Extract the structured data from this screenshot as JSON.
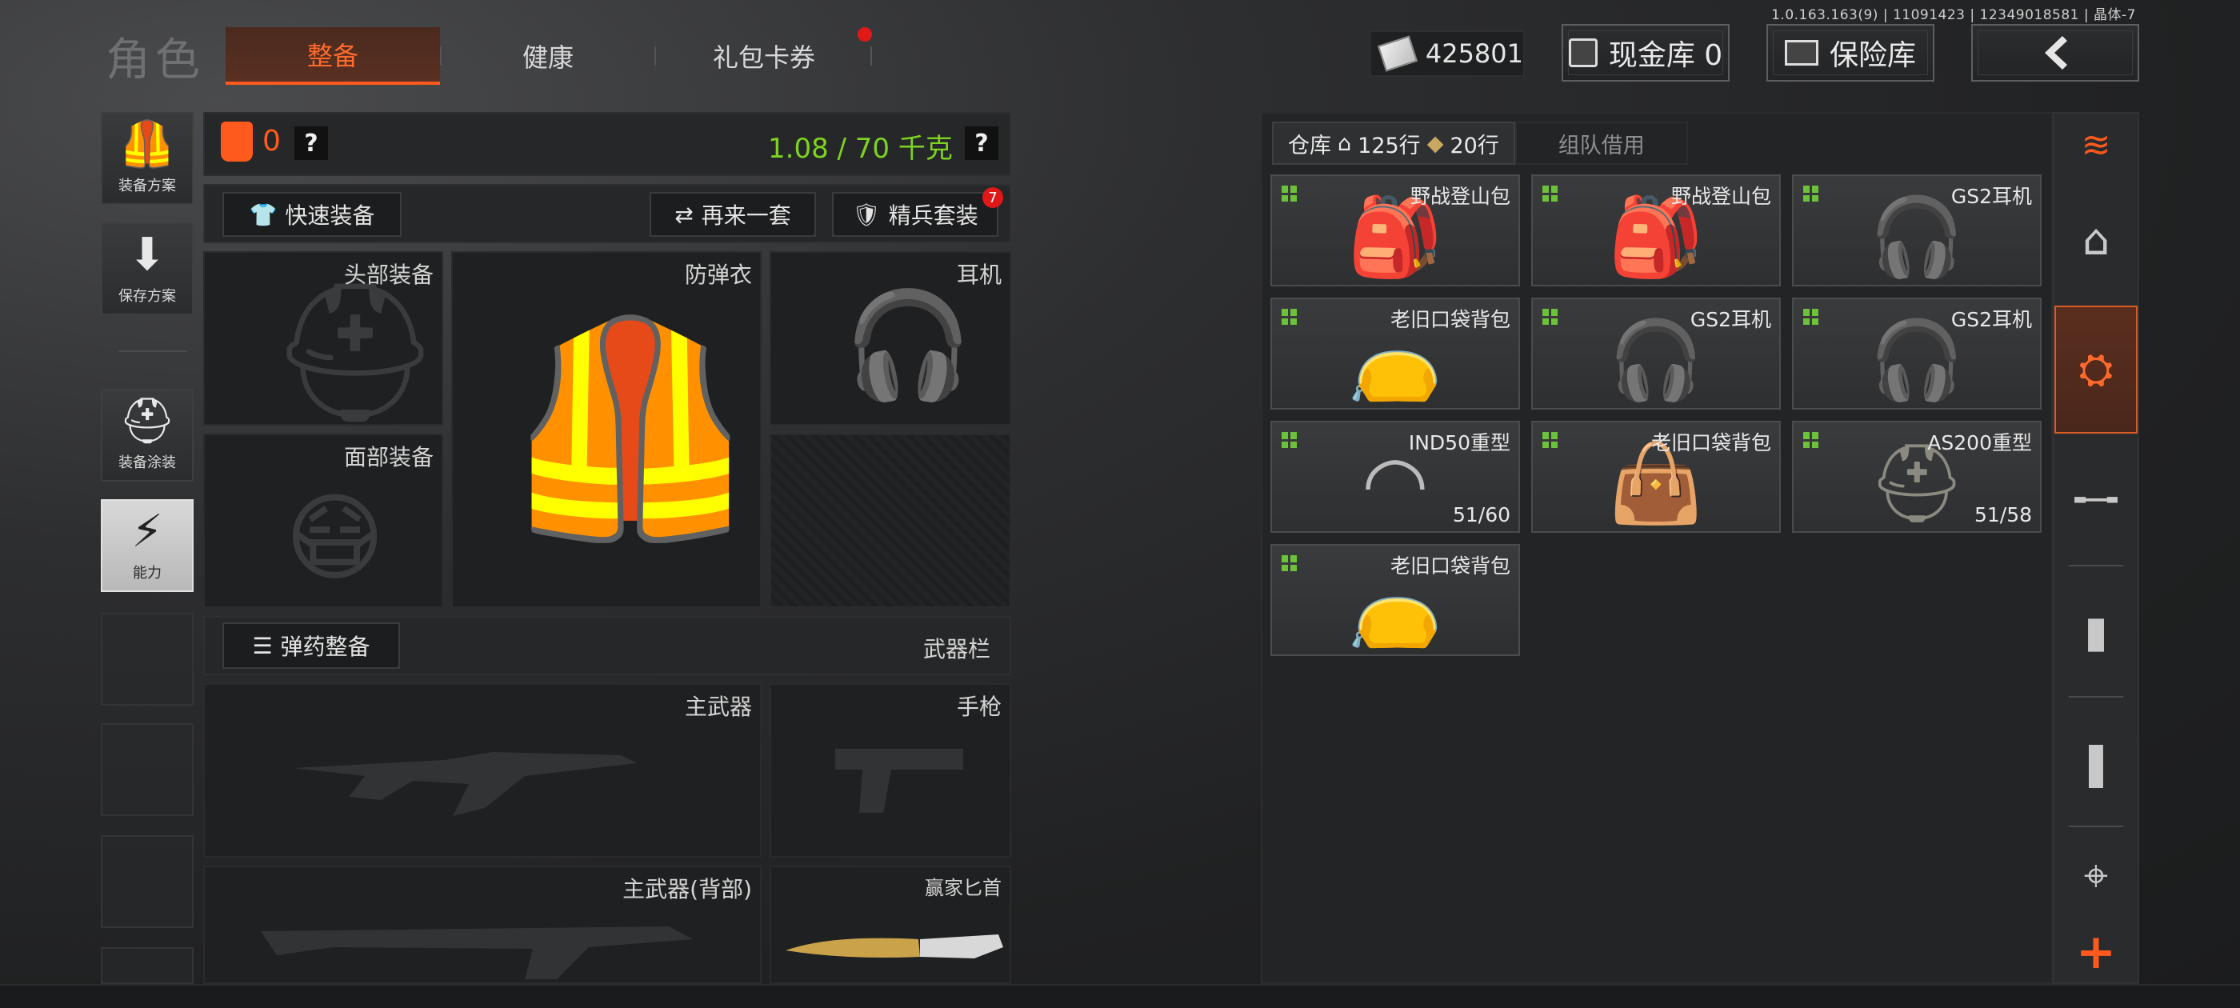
{
  "version": "1.0.163.163(9) | 11091423 | 12349018581 | 晶体-7",
  "header": {
    "title": "角色",
    "tabs": [
      {
        "label": "整备",
        "active": true
      },
      {
        "label": "健康",
        "active": false
      },
      {
        "label": "礼包卡券",
        "active": false,
        "dot": true
      }
    ],
    "money": "425801",
    "cash_vault": "现金库 0",
    "safe_box": "保险库",
    "back_icon": "chevron-left-icon"
  },
  "sidebar": {
    "items": [
      {
        "label": "装备方案",
        "icon": "armor-plan-icon"
      },
      {
        "label": "保存方案",
        "icon": "download-icon"
      },
      {
        "label": "装备涂装",
        "icon": "helmet-paint-icon"
      },
      {
        "label": "能力",
        "icon": "lightning-icon"
      }
    ]
  },
  "loadout": {
    "armor_count": "0",
    "weight": "1.08 / 70 千克",
    "help": "?",
    "quick_equip": "快速装备",
    "again_set": "再来一套",
    "elite_set": "精兵套装",
    "elite_badge": "7",
    "slots": {
      "head": "头部装备",
      "vest": "防弹衣",
      "headset": "耳机",
      "face": "面部装备",
      "ammo_equip": "弹药整备",
      "weapon_bar": "武器栏",
      "primary": "主武器",
      "pistol": "手枪",
      "primary_back": "主武器(背部)",
      "knife": "赢家匕首"
    }
  },
  "warehouse": {
    "tab_label": "仓库",
    "rows_home": "125行",
    "rows_extra": "20行",
    "team_borrow": "组队借用",
    "items": [
      {
        "name": "野战登山包",
        "count": "",
        "pic": "🎒",
        "color": "#7d8a6a"
      },
      {
        "name": "野战登山包",
        "count": "",
        "pic": "🎒",
        "color": "#7d8a6a"
      },
      {
        "name": "GS2耳机",
        "count": "",
        "pic": "🎧",
        "color": "#4a4a3a"
      },
      {
        "name": "老旧口袋背包",
        "count": "",
        "pic": "👝",
        "color": "#b0704a"
      },
      {
        "name": "GS2耳机",
        "count": "",
        "pic": "🎧",
        "color": "#4a4a3a"
      },
      {
        "name": "GS2耳机",
        "count": "",
        "pic": "🎧",
        "color": "#4a4a3a"
      },
      {
        "name": "IND50重型",
        "count": "51/60",
        "pic": "◠",
        "color": "#bbbbbb"
      },
      {
        "name": "老旧口袋背包",
        "count": "",
        "pic": "👜",
        "color": "#555555"
      },
      {
        "name": "AS200重型",
        "count": "51/58",
        "pic": "⛑",
        "color": "#8a8a80"
      },
      {
        "name": "老旧口袋背包",
        "count": "",
        "pic": "👝",
        "color": "#b0704a"
      }
    ]
  },
  "categories": [
    {
      "icon": "stack-refresh-icon",
      "active": false,
      "accent": true
    },
    {
      "icon": "home-icon",
      "active": false
    },
    {
      "icon": "equipment-icon",
      "active": true
    },
    {
      "icon": "rifle-icon",
      "active": false
    },
    {
      "icon": "magazine-icon",
      "active": false
    },
    {
      "icon": "bullet-icon",
      "active": false
    },
    {
      "icon": "scope-icon",
      "active": false
    },
    {
      "icon": "plus-icon",
      "active": false,
      "accent": true
    }
  ],
  "colors": {
    "accent": "#ff5a1e",
    "weight": "#7ed321",
    "tag": "#6cc23a"
  }
}
